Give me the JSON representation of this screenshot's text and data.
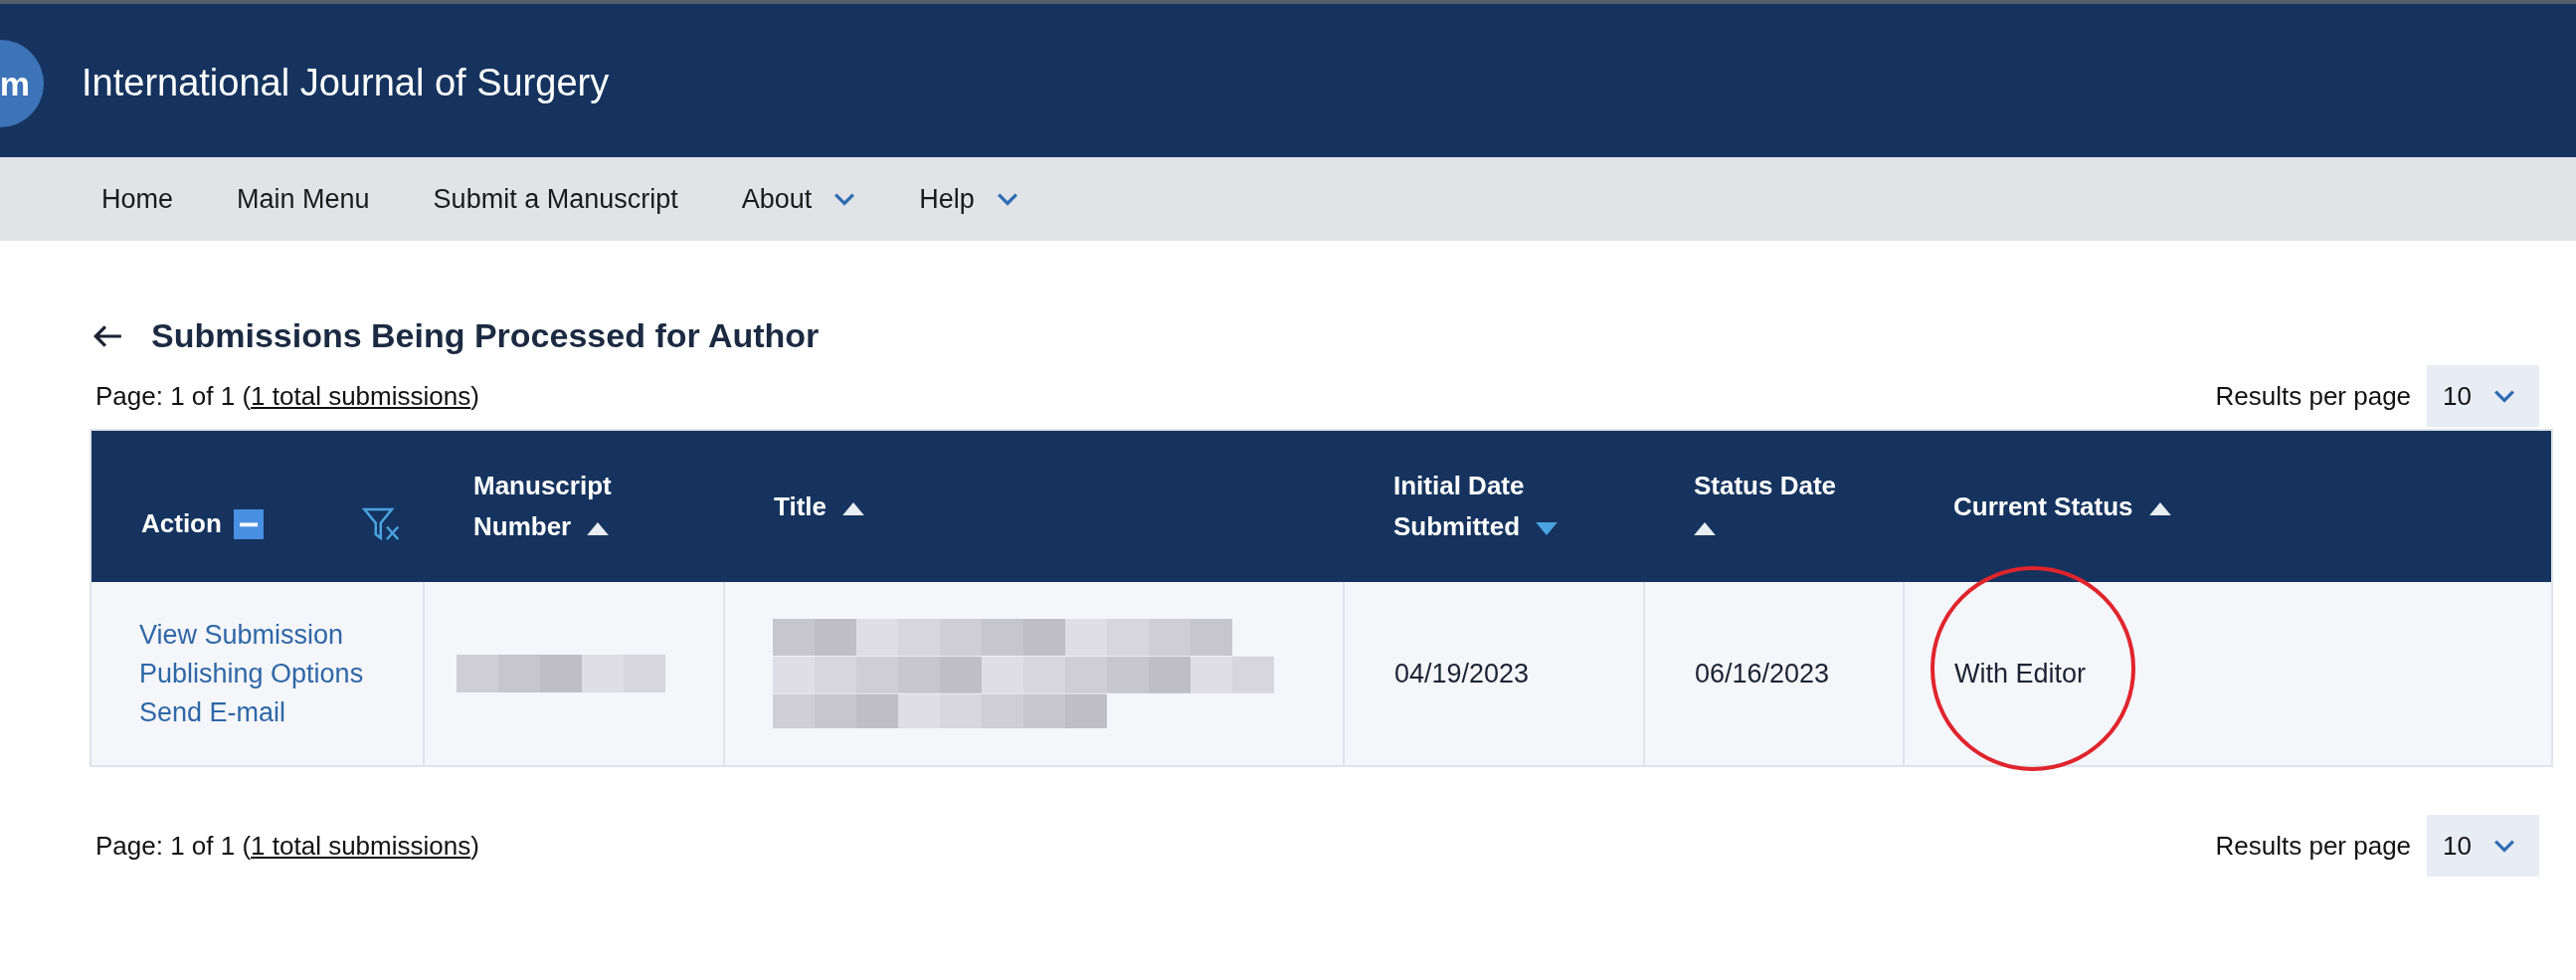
{
  "header": {
    "logo": "m",
    "title": "International Journal of Surgery"
  },
  "nav": [
    {
      "label": "Home",
      "dropdown": false
    },
    {
      "label": "Main Menu",
      "dropdown": false
    },
    {
      "label": "Submit a Manuscript",
      "dropdown": false
    },
    {
      "label": "About",
      "dropdown": true
    },
    {
      "label": "Help",
      "dropdown": true
    }
  ],
  "page_title": "Submissions Being Processed for Author",
  "pagination_top": {
    "prefix": "Page: 1 of 1 (",
    "link": "1 total submissions",
    "suffix": ")",
    "results_label": "Results per page",
    "results_value": "10"
  },
  "table": {
    "columns": [
      {
        "kind": "action",
        "label": "Action"
      },
      {
        "kind": "sortable",
        "label": "Manuscript Number",
        "descending": false,
        "active": false
      },
      {
        "kind": "sortable",
        "label": "Title",
        "descending": false,
        "active": false
      },
      {
        "kind": "sortable",
        "label": "Initial Date Submitted",
        "descending": true,
        "active": true
      },
      {
        "kind": "sortable",
        "label": "Status Date",
        "descending": false,
        "active": false
      },
      {
        "kind": "sortable",
        "label": "Current Status",
        "descending": false,
        "active": false
      }
    ],
    "rows": [
      {
        "actions": [
          "View Submission",
          "Publishing Options",
          "Send E-mail"
        ],
        "manuscript_number": {
          "kind": "redacted"
        },
        "title": {
          "kind": "redacted"
        },
        "initial_date_submitted": "04/19/2023",
        "status_date": "06/16/2023",
        "current_status": "With Editor",
        "status_circled": true
      }
    ]
  },
  "pagination_bottom": {
    "prefix": "Page: 1 of 1 (",
    "link": "1 total submissions",
    "suffix": ")",
    "results_label": "Results per page",
    "results_value": "10"
  }
}
